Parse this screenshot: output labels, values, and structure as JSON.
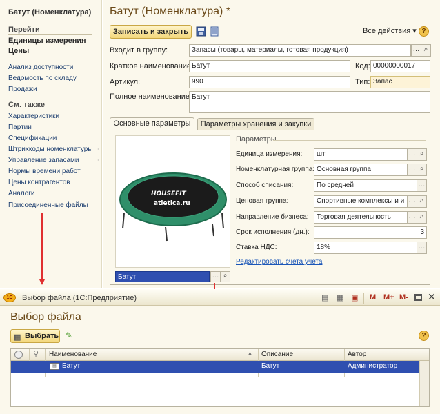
{
  "sidebar": {
    "title": "Батут (Номенклатура)",
    "goto_header": "Перейти",
    "goto_items": [
      {
        "label": "Единицы измерения"
      },
      {
        "label": "Цены"
      }
    ],
    "main_items": [
      {
        "label": "Анализ доступности"
      },
      {
        "label": "Ведомость по складу"
      },
      {
        "label": "Продажи"
      }
    ],
    "see_also_header": "См. также",
    "see_also_items": [
      {
        "label": "Характеристики"
      },
      {
        "label": "Партии"
      },
      {
        "label": "Спецификации"
      },
      {
        "label": "Штрихкоды номенклатуры"
      },
      {
        "label": "Управление запасами"
      },
      {
        "label": "Нормы времени работ"
      },
      {
        "label": "Цены контрагентов"
      },
      {
        "label": "Аналоги"
      },
      {
        "label": "Присоединенные файлы"
      }
    ]
  },
  "form": {
    "title": "Батут (Номенклатура) *",
    "save_close_label": "Записать и закрыть",
    "all_actions_label": "Все действия ▾",
    "help_label": "?",
    "group_label": "Входит в группу:",
    "group_value": "Запасы (товары, материалы, готовая продукция)",
    "short_name_label": "Краткое наименование:",
    "short_name_value": "Батут",
    "code_label": "Код:",
    "code_value": "00000000017",
    "article_label": "Артикул:",
    "article_value": "990",
    "type_label": "Тип:",
    "type_value": "Запас",
    "full_name_label": "Полное наименование:",
    "full_name_value": "Батут",
    "tabs": [
      {
        "label": "Основные параметры"
      },
      {
        "label": "Параметры хранения и закупки"
      }
    ],
    "image_brand": "HOUSEFIT",
    "image_site": "atletica.ru",
    "image_caption": "Батут",
    "params_title": "Параметры",
    "params": [
      {
        "label": "Единица измерения:",
        "value": "шт"
      },
      {
        "label": "Номенклатурная группа:",
        "value": "Основная группа"
      },
      {
        "label": "Способ списания:",
        "value": "По средней"
      },
      {
        "label": "Ценовая группа:",
        "value": "Спортивные комплексы и и"
      },
      {
        "label": "Направление бизнеса:",
        "value": "Торговая деятельность"
      },
      {
        "label": "Срок исполнения (дн.):",
        "value": "3"
      },
      {
        "label": "Ставка НДС:",
        "value": "18%"
      }
    ],
    "edit_accounts_link": "Редактировать счета учета"
  },
  "file_window": {
    "logo_text": "1С",
    "caption": "Выбор файла  (1С:Предприятие)",
    "toolbar_m": "M",
    "toolbar_mplus": "M+",
    "toolbar_mminus": "M-",
    "heading": "Выбор файла",
    "select_label": "Выбрать",
    "help_label": "?",
    "columns": {
      "name": "Наименование",
      "description": "Описание",
      "author": "Автор"
    },
    "rows": [
      {
        "name": "Батут",
        "description": "Батут",
        "author": "Администратор"
      }
    ]
  },
  "colors": {
    "accent": "#f3d77b",
    "title": "#6b4a1a",
    "link": "#1a56b8",
    "selection": "#2f4fb0",
    "arrow": "#e03030"
  }
}
